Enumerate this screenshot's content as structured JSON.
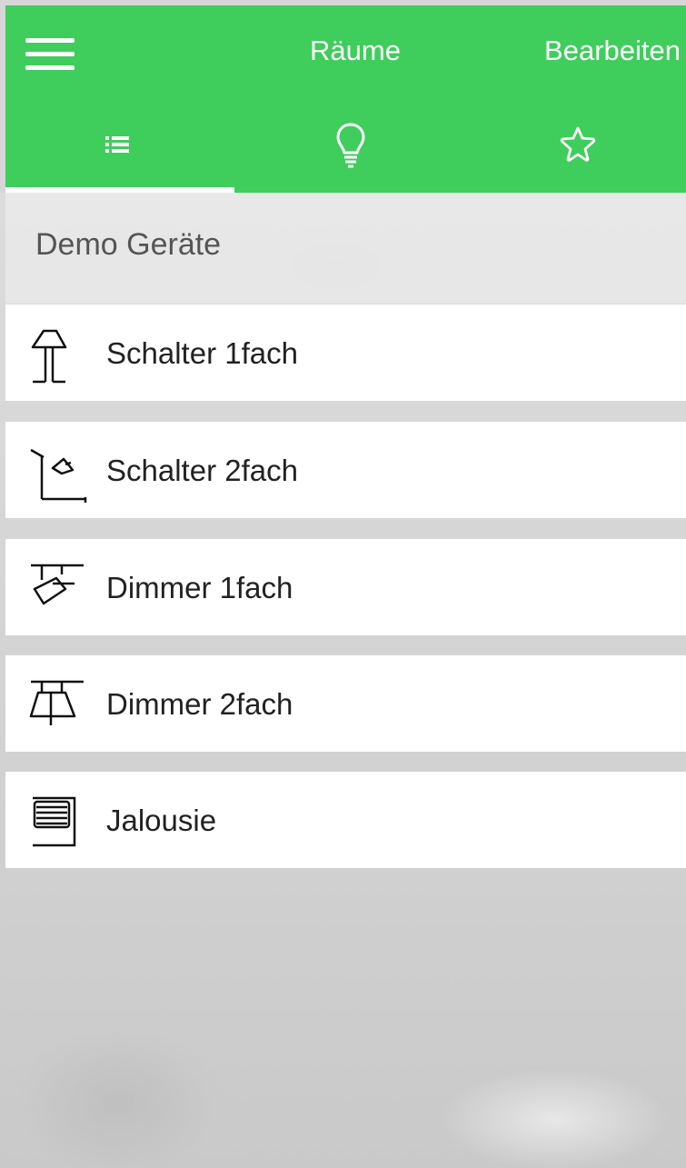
{
  "header": {
    "menu_icon": "hamburger-menu-icon",
    "title": "Räume",
    "edit_label": "Bearbeiten",
    "background_color": "#3fcd5c"
  },
  "tabs": [
    {
      "icon": "list-icon",
      "active": true
    },
    {
      "icon": "lightbulb-icon",
      "active": false
    },
    {
      "icon": "star-icon",
      "active": false
    }
  ],
  "section": {
    "title": "Demo Geräte"
  },
  "devices": [
    {
      "label": "Schalter 1fach",
      "icon": "table-lamp-icon"
    },
    {
      "label": "Schalter 2fach",
      "icon": "wall-lamp-icon"
    },
    {
      "label": "Dimmer 1fach",
      "icon": "ceiling-spot-icon"
    },
    {
      "label": "Dimmer 2fach",
      "icon": "pendant-lamp-icon"
    },
    {
      "label": "Jalousie",
      "icon": "blinds-icon"
    }
  ]
}
